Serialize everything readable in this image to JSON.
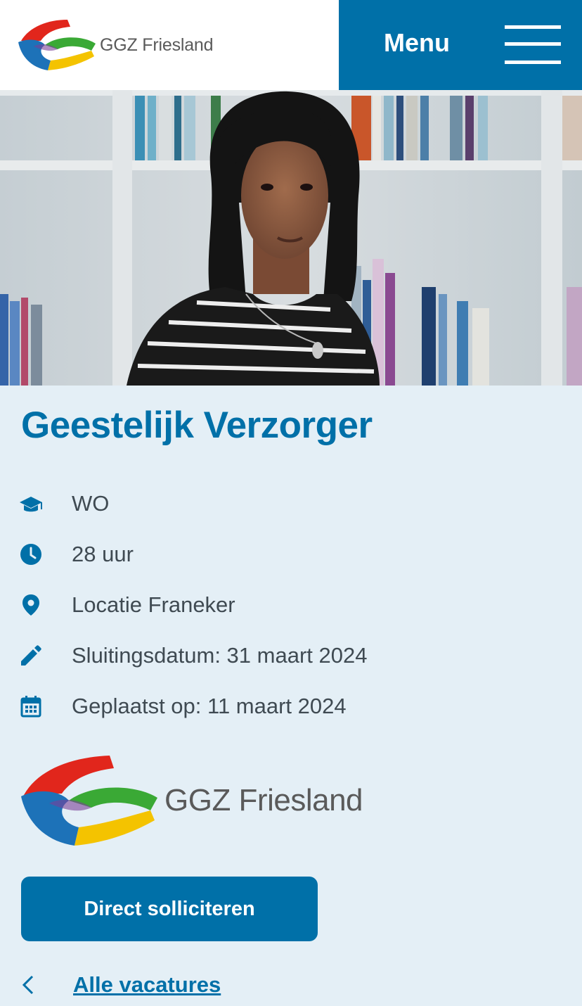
{
  "header": {
    "logo_text": "GGZ Friesland",
    "logo_icon": "ggz-friesland-logo-icon",
    "menu_label": "Menu",
    "menu_icon": "hamburger-icon"
  },
  "hero": {
    "alt": "Portrait photo of a woman in a striped shirt in front of a bookshelf"
  },
  "job": {
    "title": "Geestelijk Verzorger",
    "details": [
      {
        "icon": "graduation-cap-icon",
        "text": "WO"
      },
      {
        "icon": "clock-icon",
        "text": "28 uur"
      },
      {
        "icon": "location-pin-icon",
        "text": "Locatie Franeker"
      },
      {
        "icon": "pencil-icon",
        "text": "Sluitingsdatum: 31 maart 2024"
      },
      {
        "icon": "calendar-icon",
        "text": "Geplaatst op: 11 maart 2024"
      }
    ]
  },
  "employer": {
    "logo_text": "GGZ Friesland"
  },
  "actions": {
    "apply_label": "Direct solliciteren",
    "back_label": "Alle vacatures"
  },
  "colors": {
    "brand_blue": "#0070a8",
    "page_background": "#e4eff6",
    "text_gray": "#3f4a52",
    "logo_red": "#e1261c",
    "logo_green": "#3aa935",
    "logo_blue": "#1d72b8",
    "logo_yellow": "#f4c300"
  }
}
